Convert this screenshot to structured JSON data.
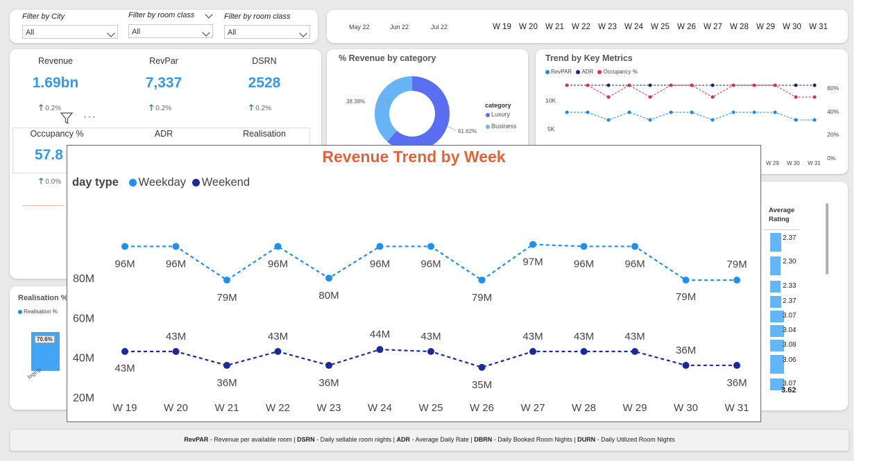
{
  "filters": [
    {
      "label": "Filter by City",
      "value": "All"
    },
    {
      "label": "Filter by room class",
      "value": "All"
    },
    {
      "label": "Filter by room class",
      "value": "All"
    }
  ],
  "timeline": {
    "months": [
      "May 22",
      "Jun 22",
      "Jul 22"
    ],
    "weeks": [
      "W 19",
      "W 20",
      "W 21",
      "W 22",
      "W 23",
      "W 24",
      "W 25",
      "W 26",
      "W 27",
      "W 28",
      "W 29",
      "W 30",
      "W 31"
    ]
  },
  "kpis": [
    {
      "title": "Revenue",
      "value": "1.69bn",
      "delta": "0.2%"
    },
    {
      "title": "RevPar",
      "value": "7,337",
      "delta": "0.2%"
    },
    {
      "title": "DSRN",
      "value": "2528",
      "delta": "0.2%"
    }
  ],
  "kpis2": [
    {
      "title": "Occupancy %",
      "value": "57.8",
      "delta": "0.0%"
    },
    {
      "title": "ADR",
      "value": "",
      "delta": ""
    },
    {
      "title": "Realisation",
      "value": "",
      "delta": ""
    }
  ],
  "donut": {
    "title": "% Revenue by category",
    "legend_title": "category",
    "items": [
      {
        "name": "Luxury",
        "pct": "61.62%",
        "value": 61.62,
        "color": "#5b6df0"
      },
      {
        "name": "Business",
        "pct": "38.38%",
        "value": 38.38,
        "color": "#66b3f5"
      }
    ]
  },
  "trend_metrics": {
    "title": "Trend by Key Metrics",
    "legend": [
      {
        "name": "RevPAR",
        "color": "#1e88e5"
      },
      {
        "name": "ADR",
        "color": "#1a237e"
      },
      {
        "name": "Occupancy %",
        "color": "#d6334a"
      }
    ],
    "y_left": [
      "10K",
      "5K"
    ],
    "y_right": [
      "60%",
      "40%",
      "20%",
      "0%"
    ],
    "x_visible": [
      "W 29",
      "W 30",
      "W 31"
    ]
  },
  "realisation": {
    "title": "Realisation %",
    "legend": "Realisation %",
    "bar_label": "70.6%",
    "bar_value": 70.6,
    "x_label": "logtrip"
  },
  "rating_table": {
    "header": "Average Rating",
    "values": [
      "2.37",
      "2.30",
      "2.33",
      "2.37",
      "3.07",
      "3.04",
      "3.08",
      "3.06",
      "3.07"
    ],
    "total": "3.62"
  },
  "focus_chart": {
    "title": "Revenue Trend by Week",
    "legend_title": "day type",
    "series_names": [
      "Weekday",
      "Weekend"
    ],
    "y_ticks": [
      "80M",
      "60M",
      "40M",
      "20M"
    ]
  },
  "chart_data": {
    "type": "line",
    "title": "Revenue Trend by Week",
    "x": [
      "W 19",
      "W 20",
      "W 21",
      "W 22",
      "W 23",
      "W 24",
      "W 25",
      "W 26",
      "W 27",
      "W 28",
      "W 29",
      "W 30",
      "W 31"
    ],
    "ylim": [
      0,
      100
    ],
    "series": [
      {
        "name": "Weekday",
        "color": "#1f8ff0",
        "values": [
          96,
          96,
          79,
          96,
          80,
          96,
          96,
          79,
          97,
          96,
          96,
          79,
          79
        ],
        "labels": [
          "96M",
          "96M",
          "79M",
          "96M",
          "80M",
          "96M",
          "96M",
          "79M",
          "97M",
          "96M",
          "96M",
          "79M",
          "79M"
        ]
      },
      {
        "name": "Weekend",
        "color": "#1a2a9a",
        "values": [
          43,
          43,
          36,
          43,
          36,
          44,
          43,
          35,
          43,
          43,
          43,
          36,
          36
        ],
        "labels": [
          "43M",
          "43M",
          "36M",
          "43M",
          "36M",
          "44M",
          "43M",
          "35M",
          "43M",
          "43M",
          "43M",
          "36M",
          "36M"
        ]
      }
    ]
  },
  "footer": [
    {
      "b": "RevPAR",
      "t": " - Revenue per available room | "
    },
    {
      "b": "DSRN",
      "t": " - Daily sellable room nights | "
    },
    {
      "b": "ADR",
      "t": " - Average Daily Rate | "
    },
    {
      "b": "DBRN",
      "t": " - Daily Booked Room Nights | "
    },
    {
      "b": "DURN",
      "t": " - Daily Utilized Room Nights"
    }
  ]
}
